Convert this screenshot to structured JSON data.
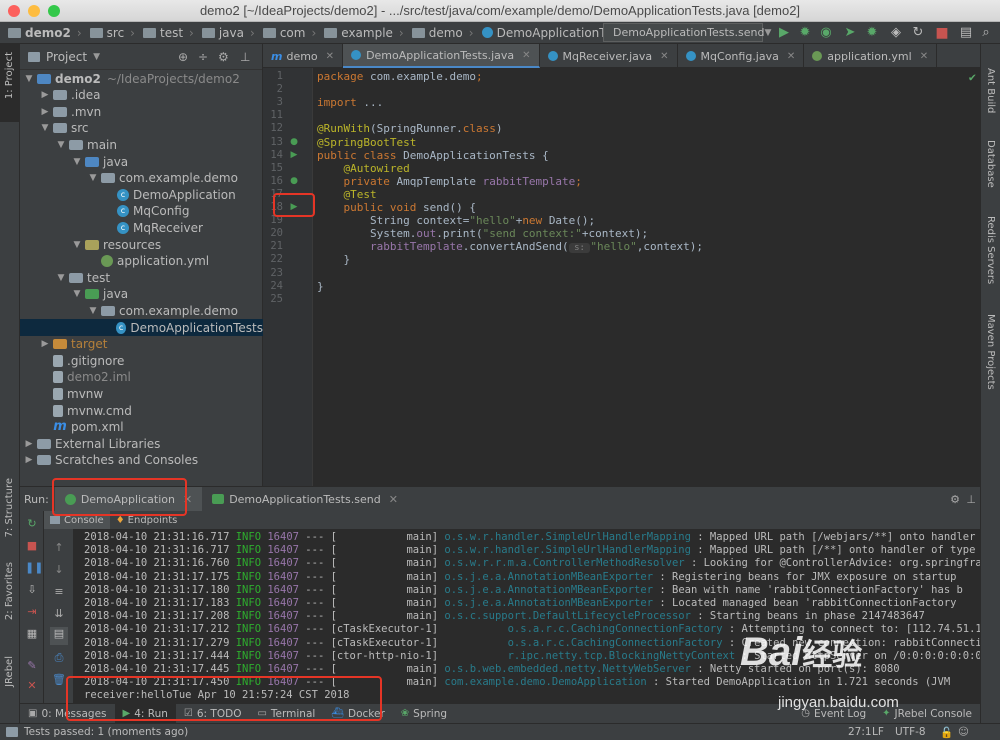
{
  "window": {
    "title": "demo2 [~/IdeaProjects/demo2] - .../src/test/java/com/example/demo/DemoApplicationTests.java [demo2]"
  },
  "navbar": {
    "crumbs": [
      "demo2",
      "src",
      "test",
      "java",
      "com",
      "example",
      "demo",
      "DemoApplicationTests"
    ],
    "run_config": "DemoApplicationTests.send"
  },
  "left_stripe": {
    "project": "1: Project",
    "structure": "7: Structure",
    "favorites": "2: Favorites",
    "jrebel": "JRebel"
  },
  "right_stripe": {
    "ant": "Ant Build",
    "database": "Database",
    "redis": "Redis Servers",
    "maven": "Maven Projects"
  },
  "project": {
    "header": "Project",
    "tree": [
      {
        "label": "demo2",
        "extra": "~/IdeaProjects/demo2",
        "icon": "folder-blue",
        "arrow": "down",
        "depth": 0
      },
      {
        "label": ".idea",
        "icon": "folder",
        "arrow": "right",
        "depth": 1
      },
      {
        "label": ".mvn",
        "icon": "folder",
        "arrow": "right",
        "depth": 1
      },
      {
        "label": "src",
        "icon": "folder",
        "arrow": "down",
        "depth": 1
      },
      {
        "label": "main",
        "icon": "folder",
        "arrow": "down",
        "depth": 2
      },
      {
        "label": "java",
        "icon": "folder-src",
        "arrow": "down",
        "depth": 3
      },
      {
        "label": "com.example.demo",
        "icon": "folder",
        "arrow": "down",
        "depth": 4
      },
      {
        "label": "DemoApplication",
        "icon": "class",
        "arrow": "",
        "depth": 5
      },
      {
        "label": "MqConfig",
        "icon": "class",
        "arrow": "",
        "depth": 5
      },
      {
        "label": "MqReceiver",
        "icon": "class",
        "arrow": "",
        "depth": 5
      },
      {
        "label": "resources",
        "icon": "folder-res",
        "arrow": "down",
        "depth": 3
      },
      {
        "label": "application.yml",
        "icon": "yml",
        "arrow": "",
        "depth": 4
      },
      {
        "label": "test",
        "icon": "folder",
        "arrow": "down",
        "depth": 2
      },
      {
        "label": "java",
        "icon": "folder-test",
        "arrow": "down",
        "depth": 3
      },
      {
        "label": "com.example.demo",
        "icon": "folder",
        "arrow": "down",
        "depth": 4
      },
      {
        "label": "DemoApplicationTests",
        "icon": "class",
        "arrow": "",
        "depth": 5,
        "selected": true
      },
      {
        "label": "target",
        "icon": "folder-orange",
        "arrow": "right",
        "depth": 1
      },
      {
        "label": ".gitignore",
        "icon": "file",
        "arrow": "",
        "depth": 1
      },
      {
        "label": "demo2.iml",
        "icon": "file",
        "arrow": "",
        "depth": 1
      },
      {
        "label": "mvnw",
        "icon": "file",
        "arrow": "",
        "depth": 1
      },
      {
        "label": "mvnw.cmd",
        "icon": "file",
        "arrow": "",
        "depth": 1
      },
      {
        "label": "pom.xml",
        "icon": "maven",
        "arrow": "",
        "depth": 1
      },
      {
        "label": "External Libraries",
        "icon": "library",
        "arrow": "right",
        "depth": 0
      },
      {
        "label": "Scratches and Consoles",
        "icon": "scratch",
        "arrow": "right",
        "depth": 0
      }
    ]
  },
  "editor": {
    "tabs": [
      {
        "label": "demo",
        "icon": "m"
      },
      {
        "label": "DemoApplicationTests.java",
        "icon": "class",
        "active": true
      },
      {
        "label": "MqReceiver.java",
        "icon": "class"
      },
      {
        "label": "MqConfig.java",
        "icon": "class"
      },
      {
        "label": "application.yml",
        "icon": "yml"
      }
    ],
    "line_numbers": [
      "1",
      "2",
      "3",
      "11",
      "12",
      "13",
      "14",
      "15",
      "16",
      "17",
      "18",
      "19",
      "20",
      "21",
      "22",
      "23",
      "24",
      "25"
    ],
    "lines": [
      [
        {
          "t": "package ",
          "c": "kw"
        },
        {
          "t": "com.example.demo",
          "c": "tp"
        },
        {
          "t": ";",
          "c": "kw"
        }
      ],
      [],
      [
        {
          "t": "import ",
          "c": "kw"
        },
        {
          "t": "...",
          "c": "tp"
        }
      ],
      [],
      [
        {
          "t": "@RunWith",
          "c": "an"
        },
        {
          "t": "(SpringRunner.",
          "c": "tp"
        },
        {
          "t": "class",
          "c": "kw"
        },
        {
          "t": ")",
          "c": "tp"
        }
      ],
      [
        {
          "t": "@SpringBootTest",
          "c": "an"
        }
      ],
      [
        {
          "t": "public class ",
          "c": "kw"
        },
        {
          "t": "DemoApplicationTests {",
          "c": "tp"
        }
      ],
      [
        {
          "t": "    @Autowired",
          "c": "an"
        }
      ],
      [
        {
          "t": "    private ",
          "c": "kw"
        },
        {
          "t": "AmqpTemplate ",
          "c": "tp"
        },
        {
          "t": "rabbitTemplate",
          "c": "fd"
        },
        {
          "t": ";",
          "c": "kw"
        }
      ],
      [
        {
          "t": "    @Test",
          "c": "an"
        }
      ],
      [
        {
          "t": "    public void ",
          "c": "kw"
        },
        {
          "t": "send() {",
          "c": "tp"
        }
      ],
      [
        {
          "t": "        String context=",
          "c": "tp"
        },
        {
          "t": "\"hello\"",
          "c": "st"
        },
        {
          "t": "+",
          "c": "tp"
        },
        {
          "t": "new ",
          "c": "kw"
        },
        {
          "t": "Date();",
          "c": "tp"
        }
      ],
      [
        {
          "t": "        System.",
          "c": "tp"
        },
        {
          "t": "out",
          "c": "fd"
        },
        {
          "t": ".print(",
          "c": "tp"
        },
        {
          "t": "\"send context:\"",
          "c": "st"
        },
        {
          "t": "+context);",
          "c": "tp"
        }
      ],
      [
        {
          "t": "        rabbitTemplate",
          "c": "fd"
        },
        {
          "t": ".convertAndSend(",
          "c": "tp"
        },
        {
          "t": " s: ",
          "c": "dim"
        },
        {
          "t": "\"hello\"",
          "c": "st"
        },
        {
          "t": ",context);",
          "c": "tp"
        }
      ],
      [
        {
          "t": "    }",
          "c": "tp"
        }
      ],
      [],
      [
        {
          "t": "}",
          "c": "tp"
        }
      ],
      []
    ]
  },
  "run": {
    "label": "Run:",
    "tabs": [
      "DemoApplication",
      "DemoApplicationTests.send"
    ],
    "subtabs": [
      "Console",
      "Endpoints"
    ],
    "log": [
      [
        "2018-04-10 21:31:16.717",
        "INFO",
        "16407",
        "---",
        "[",
        "main]",
        "o.s.w.r.handler.SimpleUrlHandlerMapping",
        ": Mapped URL path [/webjars/**] onto handler of"
      ],
      [
        "2018-04-10 21:31:16.717",
        "INFO",
        "16407",
        "---",
        "[",
        "main]",
        "o.s.w.r.handler.SimpleUrlHandlerMapping",
        ": Mapped URL path [/**] onto handler of type [c"
      ],
      [
        "2018-04-10 21:31:16.760",
        "INFO",
        "16407",
        "---",
        "[",
        "main]",
        "o.s.w.r.r.m.a.ControllerMethodResolver",
        ": Looking for @ControllerAdvice: org.springframe"
      ],
      [
        "2018-04-10 21:31:17.175",
        "INFO",
        "16407",
        "---",
        "[",
        "main]",
        "o.s.j.e.a.AnnotationMBeanExporter",
        ": Registering beans for JMX exposure on startup"
      ],
      [
        "2018-04-10 21:31:17.180",
        "INFO",
        "16407",
        "---",
        "[",
        "main]",
        "o.s.j.e.a.AnnotationMBeanExporter",
        ": Bean with name 'rabbitConnectionFactory' has b"
      ],
      [
        "2018-04-10 21:31:17.183",
        "INFO",
        "16407",
        "---",
        "[",
        "main]",
        "o.s.j.e.a.AnnotationMBeanExporter",
        ": Located managed bean 'rabbitConnectionFactory"
      ],
      [
        "2018-04-10 21:31:17.208",
        "INFO",
        "16407",
        "---",
        "[",
        "main]",
        "o.s.c.support.DefaultLifecycleProcessor",
        ": Starting beans in phase 2147483647"
      ],
      [
        "2018-04-10 21:31:17.212",
        "INFO",
        "16407",
        "---",
        "[cTaskExecutor-1]",
        "",
        "o.s.a.r.c.CachingConnectionFactory",
        ": Attempting to connect to: [112.74.51.136:14002"
      ],
      [
        "2018-04-10 21:31:17.279",
        "INFO",
        "16407",
        "---",
        "[cTaskExecutor-1]",
        "",
        "o.s.a.r.c.CachingConnectionFactory",
        ": Created new connection: rabbitConnectionFactor"
      ],
      [
        "2018-04-10 21:31:17.444",
        "INFO",
        "16407",
        "---",
        "[ctor-http-nio-1]",
        "",
        "r.ipc.netty.tcp.BlockingNettyContext",
        ": Started HttpServer on /0:0:0:0:0:0:0:0:8080"
      ],
      [
        "2018-04-10 21:31:17.445",
        "INFO",
        "16407",
        "---",
        "[",
        "main]",
        "o.s.b.web.embedded.netty.NettyWebServer",
        ": Netty started on port(s): 8080"
      ],
      [
        "2018-04-10 21:31:17.450",
        "INFO",
        "16407",
        "---",
        "[",
        "main]",
        "com.example.demo.DemoApplication",
        ": Started DemoApplication in 1.721 seconds (JVM"
      ]
    ],
    "receiver_line": "receiver:helloTue Apr 10 21:57:24 CST 2018"
  },
  "bottom_tabs": [
    "0: Messages",
    "4: Run",
    "6: TODO",
    "Terminal",
    "Docker",
    "Spring",
    "Event Log",
    "JRebel Console"
  ],
  "status": {
    "message": "Tests passed: 1 (moments ago)",
    "position": "27:1",
    "line_sep": "LF",
    "encoding": "UTF-8"
  },
  "watermark": {
    "brand": "Bai",
    "brand2": "经验",
    "url": "jingyan.baidu.com"
  },
  "colors": {
    "accent": "#4a88c7",
    "highlight": "#e53526",
    "bg": "#2b2b2b"
  }
}
